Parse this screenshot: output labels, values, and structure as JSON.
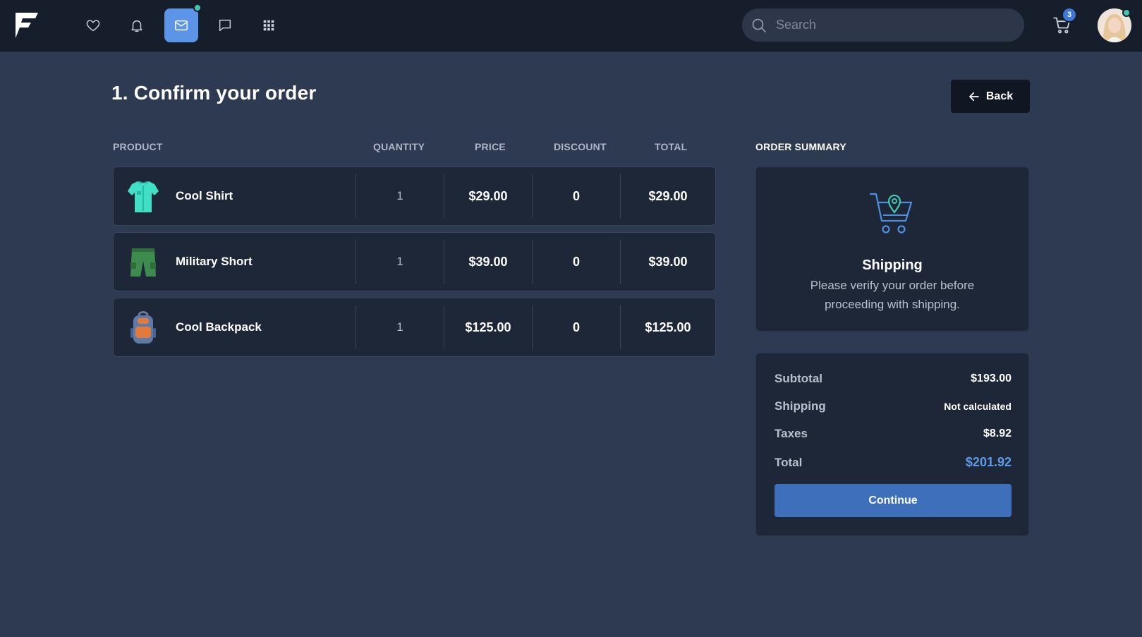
{
  "header": {
    "search_placeholder": "Search",
    "cart_count": "3"
  },
  "page": {
    "title": "1. Confirm your order",
    "back_label": "Back"
  },
  "table": {
    "columns": [
      "PRODUCT",
      "QUANTITY",
      "PRICE",
      "DISCOUNT",
      "TOTAL"
    ],
    "rows": [
      {
        "name": "Cool Shirt",
        "icon": "shirt-icon",
        "quantity": "1",
        "price": "$29.00",
        "discount": "0",
        "total": "$29.00"
      },
      {
        "name": "Military Short",
        "icon": "shorts-icon",
        "quantity": "1",
        "price": "$39.00",
        "discount": "0",
        "total": "$39.00"
      },
      {
        "name": "Cool Backpack",
        "icon": "backpack-icon",
        "quantity": "1",
        "price": "$125.00",
        "discount": "0",
        "total": "$125.00"
      }
    ]
  },
  "summary": {
    "heading": "ORDER SUMMARY",
    "shipping_title": "Shipping",
    "shipping_text": "Please verify your order before proceeding with shipping.",
    "subtotal_label": "Subtotal",
    "subtotal_value": "$193.00",
    "shipping_label": "Shipping",
    "shipping_value": "Not calculated",
    "taxes_label": "Taxes",
    "taxes_value": "$8.92",
    "total_label": "Total",
    "total_value": "$201.92",
    "continue_label": "Continue"
  },
  "colors": {
    "background": "#2e3a52",
    "topbar": "#161d2b",
    "card": "#1e2738",
    "accent": "#5c95e8",
    "primary_button": "#3d6fbb",
    "notification_dot": "#41c9b0"
  }
}
